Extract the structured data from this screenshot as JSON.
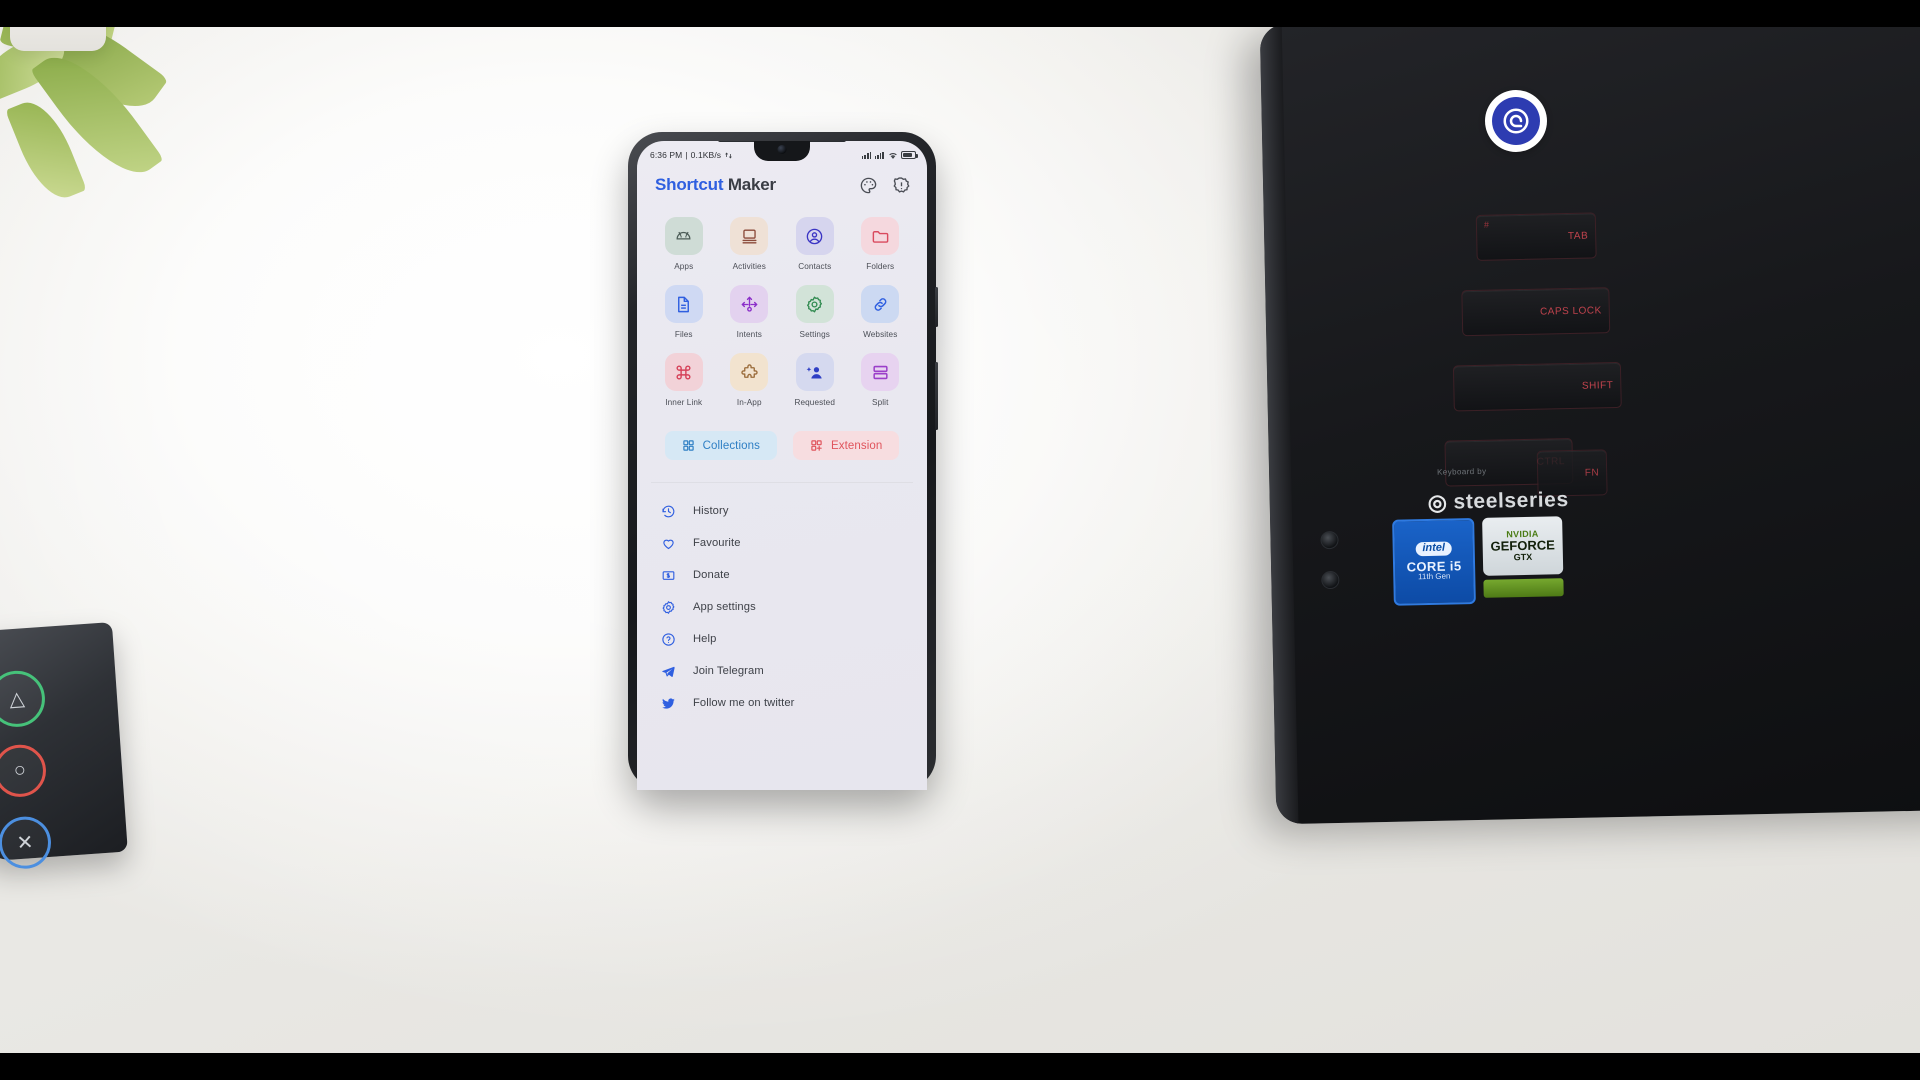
{
  "phone": {
    "statusbar": {
      "time": "6:36 PM",
      "separator": "|",
      "network_speed": "0.1KB/s",
      "data_icon": "data-transfer-icon",
      "icons": [
        "signal-bars-icon",
        "signal-bars-icon",
        "wifi-icon",
        "battery-icon"
      ]
    },
    "header": {
      "title_primary": "Shortcut",
      "title_secondary": " Maker",
      "actions": [
        {
          "name": "theme-palette-icon",
          "label": "Theme"
        },
        {
          "name": "info-alert-icon",
          "label": "Info"
        }
      ]
    },
    "grid": [
      {
        "label": "Apps",
        "icon": "android-robot-icon",
        "tile_bg": "#cfdcd6",
        "icon_color": "#4c5c57"
      },
      {
        "label": "Activities",
        "icon": "monitor-lines-icon",
        "tile_bg": "#efe1d6",
        "icon_color": "#8b4a3a"
      },
      {
        "label": "Contacts",
        "icon": "user-circle-icon",
        "tile_bg": "#d6d5ee",
        "icon_color": "#3b35c4"
      },
      {
        "label": "Folders",
        "icon": "folder-icon",
        "tile_bg": "#f5d8de",
        "icon_color": "#d94a5e"
      },
      {
        "label": "Files",
        "icon": "file-document-icon",
        "tile_bg": "#cfd9f3",
        "icon_color": "#2f5fe0"
      },
      {
        "label": "Intents",
        "icon": "intent-arrows-icon",
        "tile_bg": "#e3d2ef",
        "icon_color": "#8b2fc9"
      },
      {
        "label": "Settings",
        "icon": "gear-icon",
        "tile_bg": "#d2e3d8",
        "icon_color": "#2f8a4f"
      },
      {
        "label": "Websites",
        "icon": "link-chain-icon",
        "tile_bg": "#ccd9f2",
        "icon_color": "#2f5fe0"
      },
      {
        "label": "Inner Link",
        "icon": "command-key-icon",
        "tile_bg": "#f2d2d8",
        "icon_color": "#d6435a"
      },
      {
        "label": "In-App",
        "icon": "puzzle-piece-icon",
        "tile_bg": "#f2e3cf",
        "icon_color": "#9a6b3a"
      },
      {
        "label": "Requested",
        "icon": "user-add-star-icon",
        "tile_bg": "#d5d9ef",
        "icon_color": "#2f3fc4"
      },
      {
        "label": "Split",
        "icon": "split-screen-icon",
        "tile_bg": "#e7d3f0",
        "icon_color": "#9b3fc9"
      }
    ],
    "chips": [
      {
        "label": "Collections",
        "icon": "grid-squares-icon",
        "bg": "#d6e8f5",
        "color": "#2f7fc4"
      },
      {
        "label": "Extension",
        "icon": "grid-plus-icon",
        "bg": "#f7dde0",
        "color": "#e0545c"
      }
    ],
    "menu": [
      {
        "label": "History",
        "icon": "history-clock-icon"
      },
      {
        "label": "Favourite",
        "icon": "heart-icon"
      },
      {
        "label": "Donate",
        "icon": "money-bill-icon"
      },
      {
        "label": "App settings",
        "icon": "gear-icon"
      },
      {
        "label": "Help",
        "icon": "question-circle-icon"
      },
      {
        "label": "Join Telegram",
        "icon": "telegram-paper-plane-icon"
      },
      {
        "label": "Follow me on twitter",
        "icon": "twitter-bird-icon"
      }
    ]
  },
  "scene": {
    "laptop": {
      "keys": [
        {
          "name": "tab-key",
          "label": "TAB",
          "num": "#"
        },
        {
          "name": "caps-key",
          "label": "CAPS LOCK",
          "num": ""
        },
        {
          "name": "shift-key",
          "label": "SHIFT",
          "num": ""
        },
        {
          "name": "ctrl-key",
          "label": "CTRL",
          "num": ""
        },
        {
          "name": "fn-key",
          "label": "FN",
          "num": ""
        }
      ],
      "brand": "steelseries",
      "brand_sub": "Keyboard by",
      "badges": {
        "intel_top": "intel",
        "intel_core": "CORE i5",
        "intel_gen": "11th Gen",
        "nvidia_n": "NVIDIA",
        "nvidia_g": "GEFORCE",
        "nvidia_x": "GTX"
      }
    },
    "gamepad": {
      "buttons": [
        {
          "name": "triangle-button",
          "glyph": "△",
          "color": "#46c27a"
        },
        {
          "name": "circle-button",
          "glyph": "○",
          "color": "#e0544b"
        },
        {
          "name": "cross-button",
          "glyph": "✕",
          "color": "#4c8fe0"
        }
      ]
    },
    "watermark": {
      "name": "spiral-logo-watermark"
    }
  }
}
